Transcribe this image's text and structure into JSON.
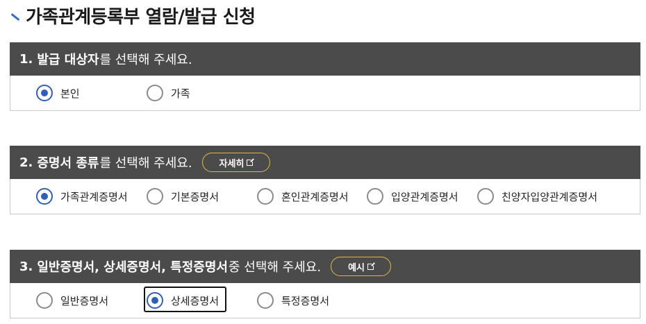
{
  "page": {
    "title": "가족관계등록부 열람/발급 신청"
  },
  "sections": [
    {
      "number": "1.",
      "strong": "발급 대상자",
      "rest": "를 선택해 주세요.",
      "options": [
        {
          "label": "본인",
          "checked": true
        },
        {
          "label": "가족",
          "checked": false
        }
      ]
    },
    {
      "number": "2.",
      "strong": "증명서 종류",
      "rest": "를 선택해 주세요.",
      "button": "자세히",
      "options": [
        {
          "label": "가족관계증명서",
          "checked": true
        },
        {
          "label": "기본증명서",
          "checked": false
        },
        {
          "label": "혼인관계증명서",
          "checked": false
        },
        {
          "label": "입양관계증명서",
          "checked": false
        },
        {
          "label": "친양자입양관계증명서",
          "checked": false
        }
      ]
    },
    {
      "number": "3.",
      "strong": "일반증명서, 상세증명서, 특정증명서",
      "rest": " 중 선택해 주세요.",
      "button": "예시",
      "options": [
        {
          "label": "일반증명서",
          "checked": false
        },
        {
          "label": "상세증명서",
          "checked": true
        },
        {
          "label": "특정증명서",
          "checked": false
        }
      ]
    }
  ]
}
